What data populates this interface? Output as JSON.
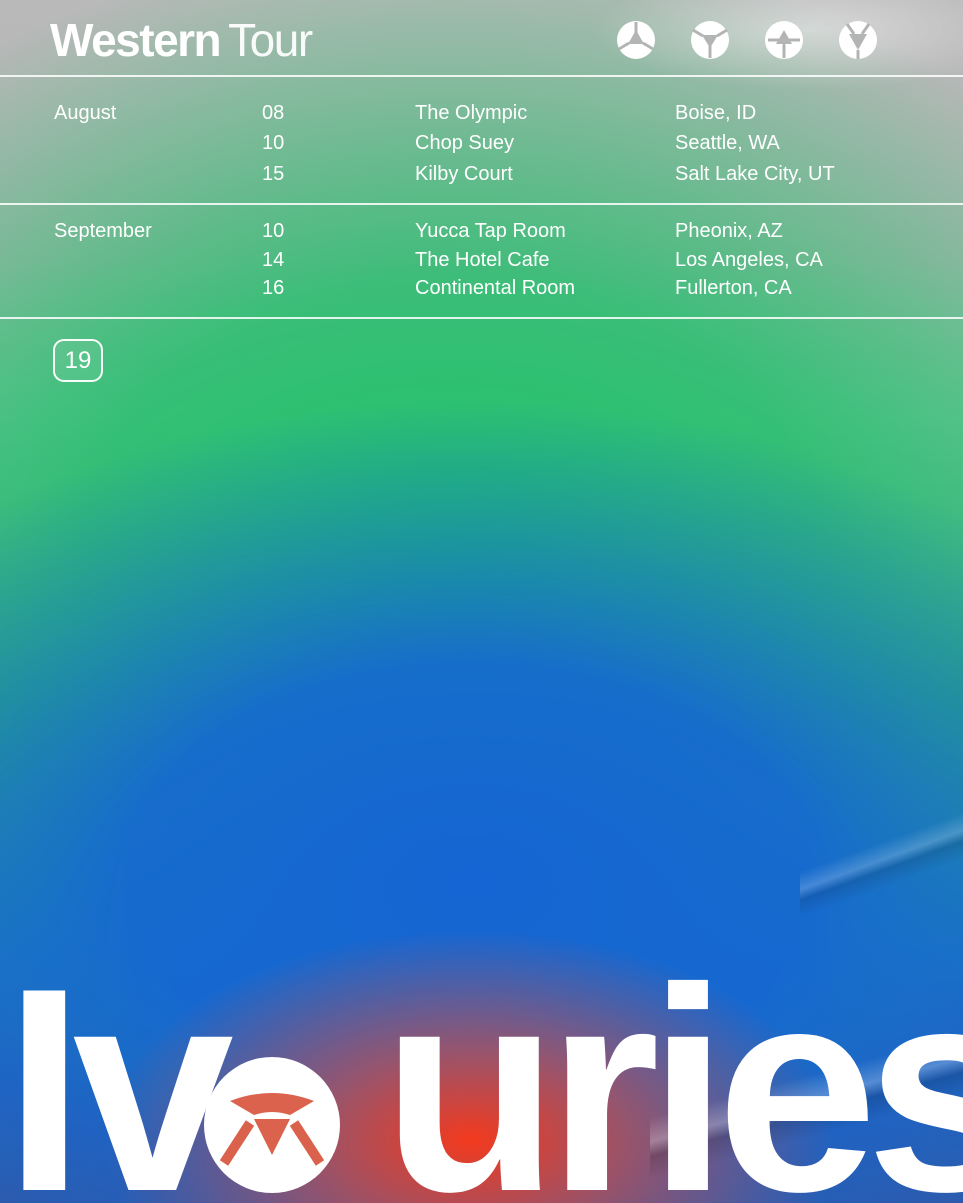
{
  "poster": {
    "title_bold": "Western",
    "title_light": "Tour",
    "logo_icons": [
      "ivouries-logo-icon",
      "ivouries-logo-icon",
      "ivouries-logo-icon",
      "ivouries-logo-icon"
    ],
    "year_badge": "19",
    "band_name_before": "Iv",
    "band_name_after": "uries",
    "colors": {
      "header_gray": "#b9b9b9",
      "green": "#20c46a",
      "blue": "#1565d4",
      "red": "#ff3714",
      "text": "#ffffff"
    }
  },
  "schedule": {
    "august": {
      "month": "August",
      "shows": [
        {
          "day": "08",
          "venue": "The Olympic",
          "city": "Boise, ID"
        },
        {
          "day": "10",
          "venue": "Chop Suey",
          "city": "Seattle, WA"
        },
        {
          "day": "15",
          "venue": "Kilby Court",
          "city": "Salt Lake City, UT"
        }
      ]
    },
    "september": {
      "month": "September",
      "shows": [
        {
          "day": "10",
          "venue": "Yucca Tap Room",
          "city": "Pheonix, AZ"
        },
        {
          "day": "14",
          "venue": "The Hotel Cafe",
          "city": "Los Angeles, CA"
        },
        {
          "day": "16",
          "venue": "Continental Room",
          "city": "Fullerton, CA"
        }
      ]
    }
  }
}
